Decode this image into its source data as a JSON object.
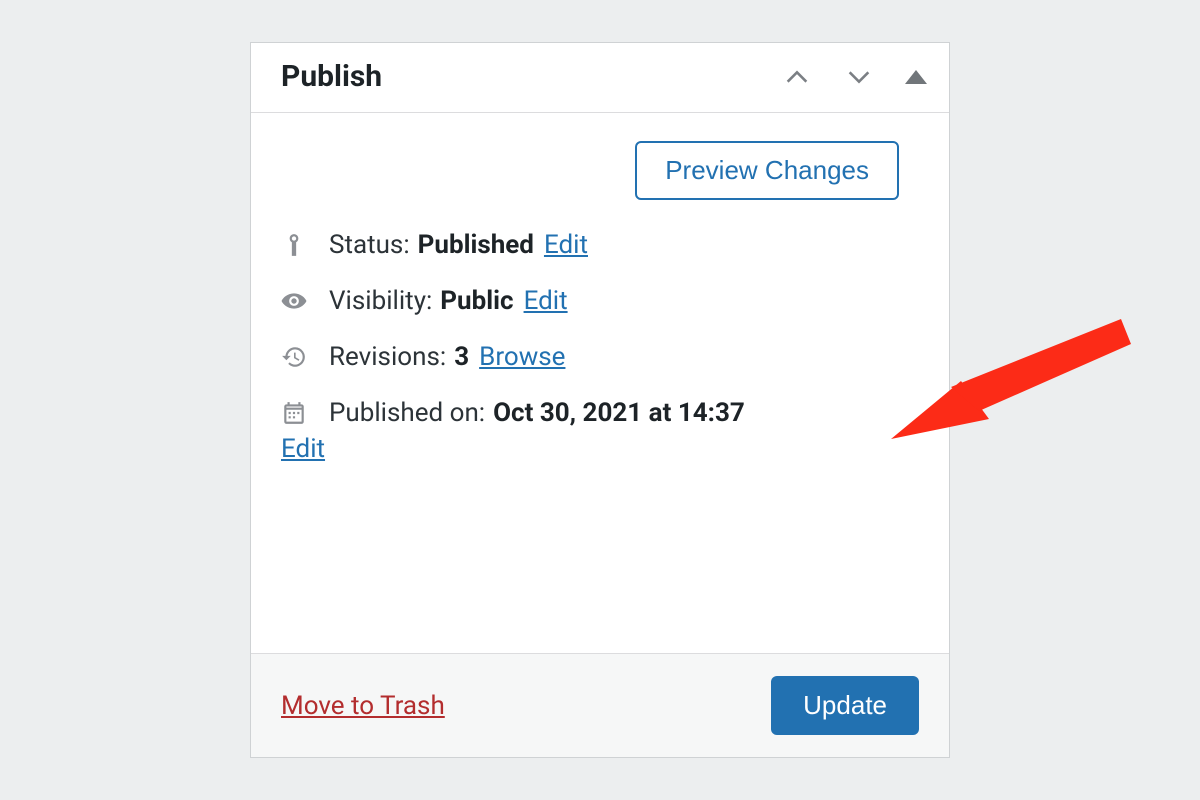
{
  "publish_box": {
    "title": "Publish",
    "preview_button_label": "Preview Changes",
    "status": {
      "label": "Status:",
      "value": "Published",
      "edit_link": "Edit"
    },
    "visibility": {
      "label": "Visibility:",
      "value": "Public",
      "edit_link": "Edit"
    },
    "revisions": {
      "label": "Revisions:",
      "count": "3",
      "browse_link": "Browse"
    },
    "published_on": {
      "label": "Published on:",
      "value": "Oct 30, 2021 at 14:37",
      "edit_link": "Edit"
    },
    "footer": {
      "trash_label": "Move to Trash",
      "update_label": "Update"
    }
  },
  "colors": {
    "link_blue": "#2271b1",
    "danger_red": "#b32d2e",
    "arrow_red": "#fc2b17"
  }
}
